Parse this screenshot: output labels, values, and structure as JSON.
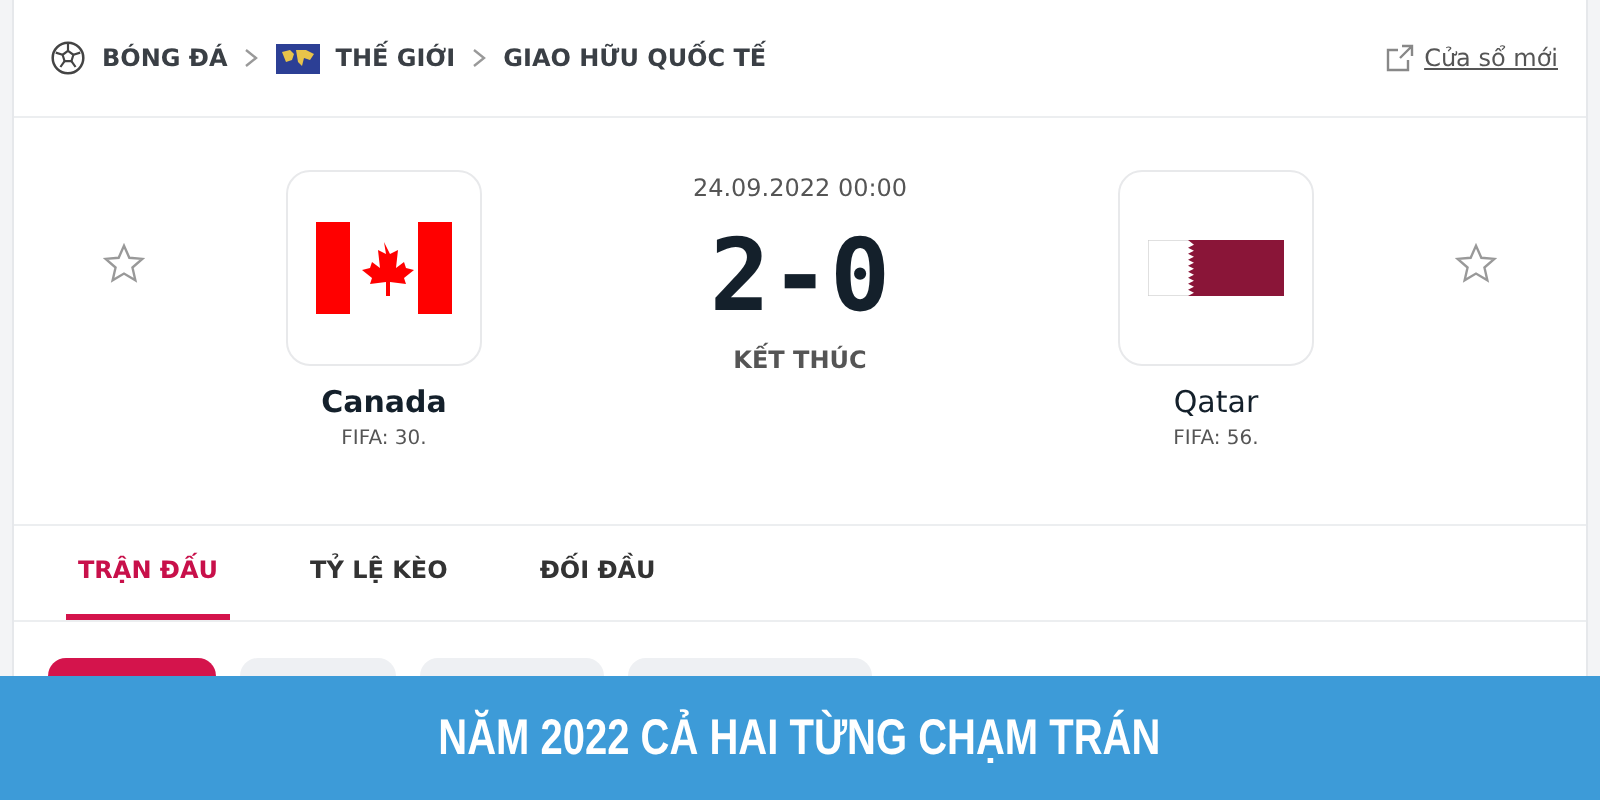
{
  "breadcrumb": [
    {
      "kind": "ball",
      "label": "BÓNG ĐÁ"
    },
    {
      "kind": "map",
      "label": "THẾ GIỚI"
    },
    {
      "kind": "none",
      "label": "GIAO HỮU QUỐC TẾ"
    }
  ],
  "new_window_link": "Cửa sổ mới",
  "match": {
    "datetime": "24.09.2022 00:00",
    "score": "2-0",
    "status": "KẾT THÚC",
    "home": {
      "name": "Canada",
      "ranking": "FIFA: 30.",
      "kind": "canada",
      "winner": true,
      "favorite": false
    },
    "away": {
      "name": "Qatar",
      "ranking": "FIFA: 56.",
      "kind": "qatar",
      "winner": false,
      "favorite": false
    }
  },
  "tabs": [
    {
      "label": "TRẬN ĐẤU",
      "selected": true
    },
    {
      "label": "TỶ LỆ KÈO",
      "selected": false
    },
    {
      "label": "ĐỐI ĐẦU",
      "selected": false
    }
  ],
  "filter_chips": [
    {
      "selected": true
    },
    {
      "selected": false
    },
    {
      "selected": false
    },
    {
      "selected": false
    }
  ],
  "banner": "NĂM 2022 CẢ HAI TỪNG CHẠM TRÁN"
}
